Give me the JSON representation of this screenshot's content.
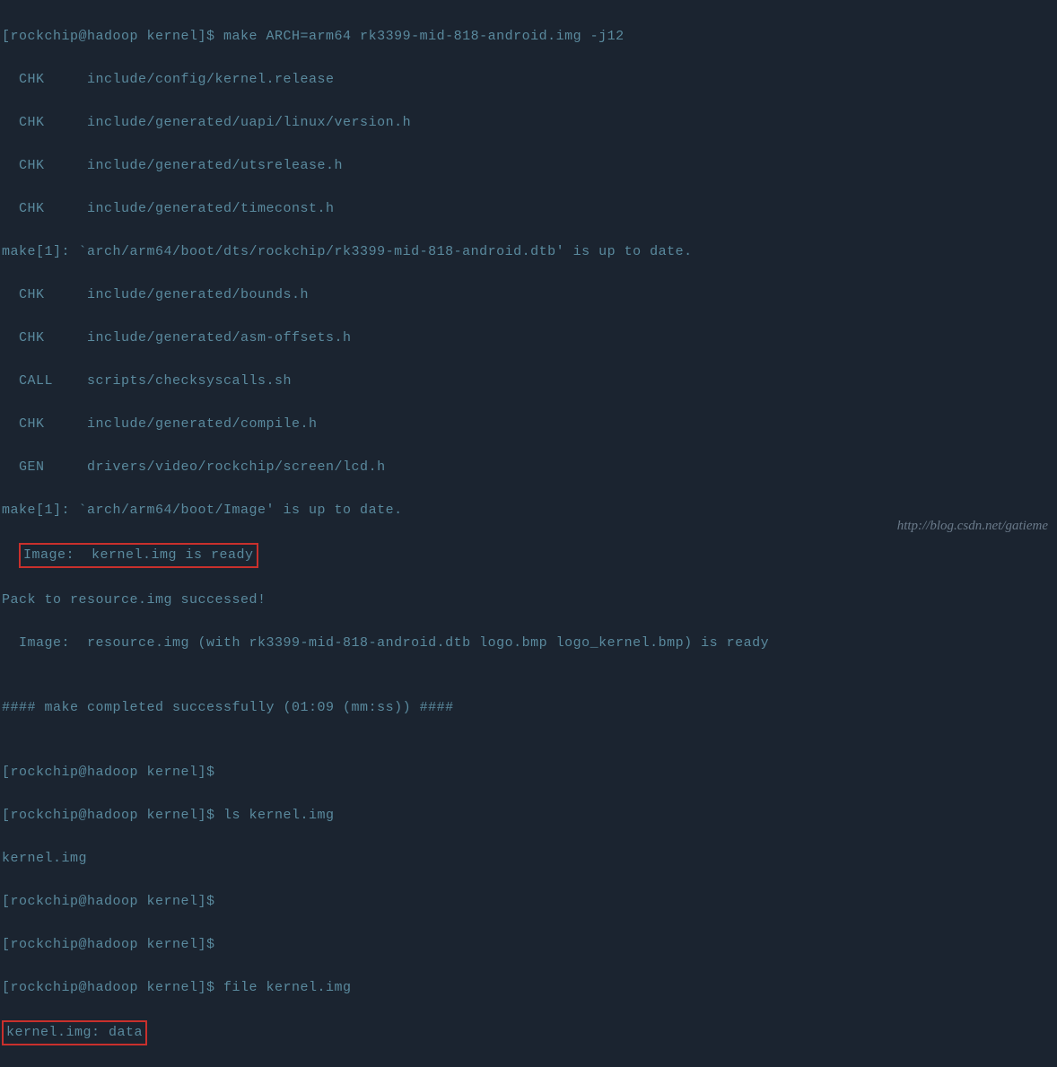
{
  "terminal": {
    "lines": [
      "[rockchip@hadoop kernel]$ make ARCH=arm64 rk3399-mid-818-android.img -j12",
      "  CHK     include/config/kernel.release",
      "  CHK     include/generated/uapi/linux/version.h",
      "  CHK     include/generated/utsrelease.h",
      "  CHK     include/generated/timeconst.h",
      "make[1]: `arch/arm64/boot/dts/rockchip/rk3399-mid-818-android.dtb' is up to date.",
      "  CHK     include/generated/bounds.h",
      "  CHK     include/generated/asm-offsets.h",
      "  CALL    scripts/checksyscalls.sh",
      "  CHK     include/generated/compile.h",
      "  GEN     drivers/video/rockchip/screen/lcd.h",
      "make[1]: `arch/arm64/boot/Image' is up to date."
    ],
    "highlight1_prefix": "  ",
    "highlight1_text": "Image:  kernel.img is ready",
    "lines2": [
      "Pack to resource.img successed!",
      "  Image:  resource.img (with rk3399-mid-818-android.dtb logo.bmp logo_kernel.bmp) is ready",
      "",
      "#### make completed successfully (01:09 (mm:ss)) ####",
      "",
      "[rockchip@hadoop kernel]$",
      "[rockchip@hadoop kernel]$ ls kernel.img",
      "kernel.img",
      "[rockchip@hadoop kernel]$",
      "[rockchip@hadoop kernel]$",
      "[rockchip@hadoop kernel]$ file kernel.img"
    ],
    "highlight2_text": "kernel.img: data"
  },
  "watermark": "http://blog.csdn.net/gatieme"
}
